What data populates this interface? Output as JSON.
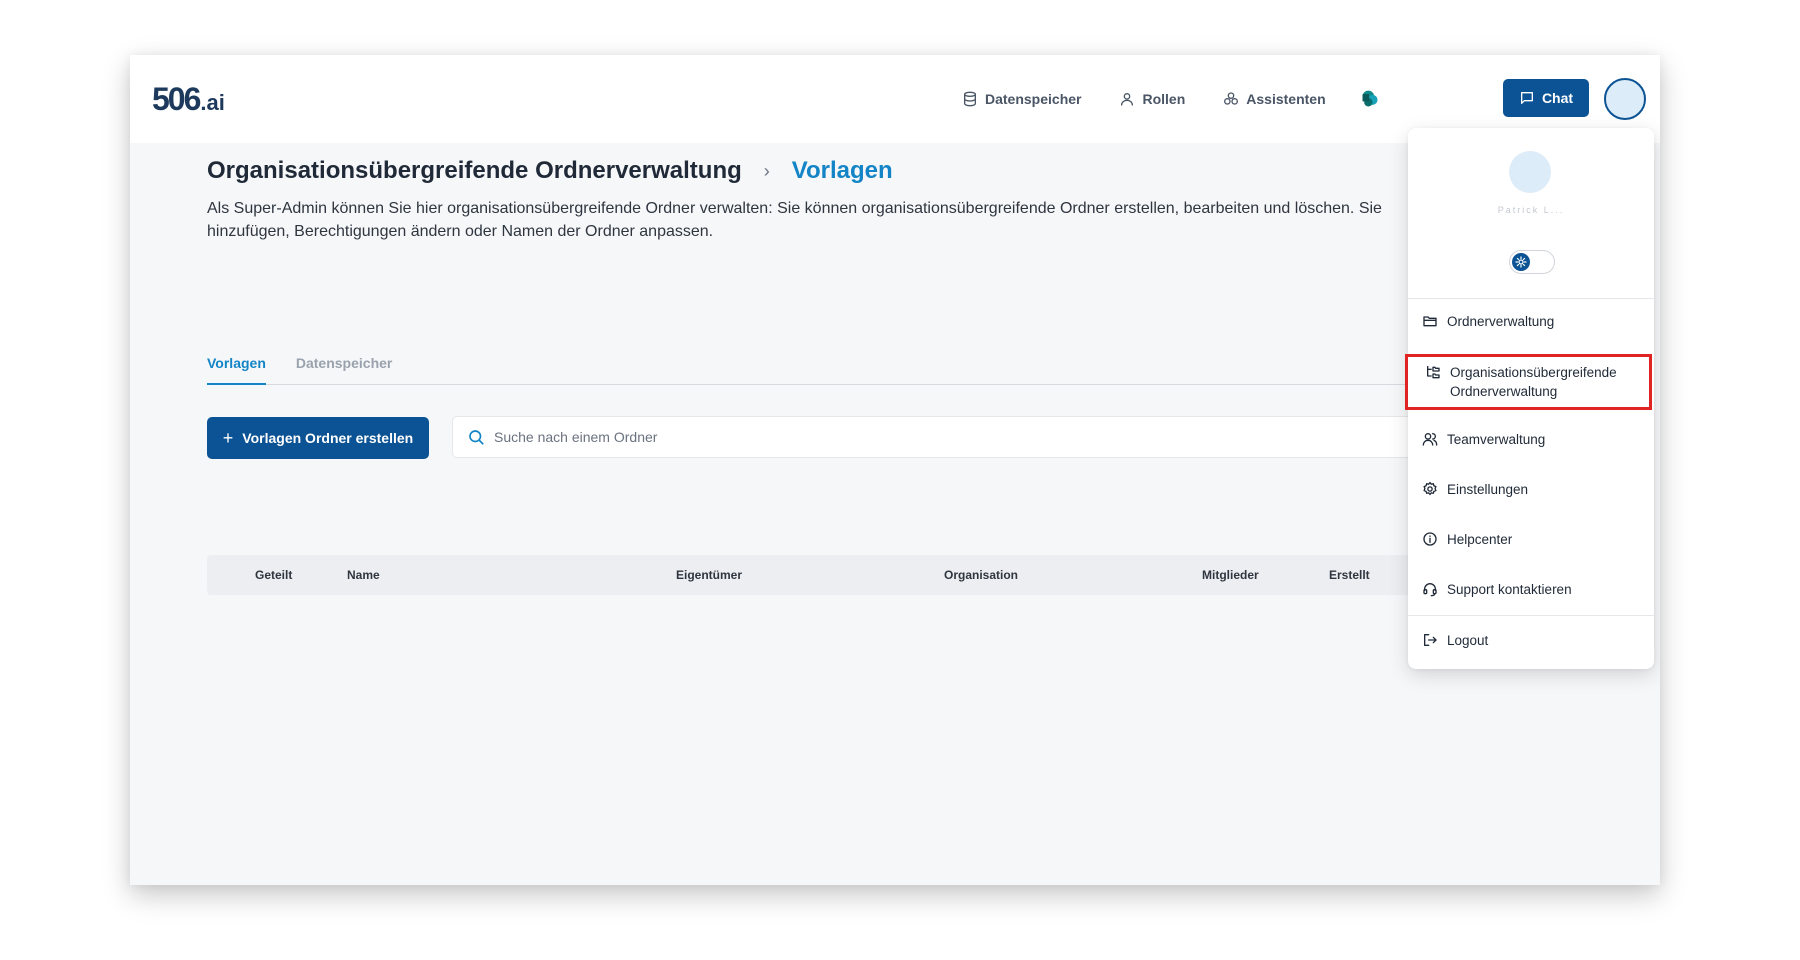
{
  "header": {
    "logo_number": "506",
    "logo_suffix": ".ai",
    "nav": [
      {
        "label": "Datenspeicher",
        "icon": "database-icon"
      },
      {
        "label": "Rollen",
        "icon": "user-icon"
      },
      {
        "label": "Assistenten",
        "icon": "assistants-icon"
      }
    ],
    "chat_label": "Chat"
  },
  "page": {
    "breadcrumb_root": "Organisationsübergreifende Ordnerverwaltung",
    "breadcrumb_separator": "›",
    "breadcrumb_current": "Vorlagen",
    "description": "Als Super-Admin können Sie hier organisationsübergreifende Ordner verwalten: Sie können organisationsübergreifende Ordner erstellen, bearbeiten und löschen. Sie hinzufügen, Berechtigungen ändern oder Namen der Ordner anpassen.",
    "tabs": [
      {
        "label": "Vorlagen",
        "active": true
      },
      {
        "label": "Datenspeicher",
        "active": false
      }
    ],
    "create_button": "Vorlagen Ordner erstellen",
    "search_placeholder": "Suche nach einem Ordner",
    "table_headers": [
      "Geteilt",
      "Name",
      "Eigentümer",
      "Organisation",
      "Mitglieder",
      "Erstellt"
    ]
  },
  "user_menu": {
    "username": "Patrick L...",
    "items": [
      {
        "label": "Ordnerverwaltung",
        "icon": "folder-icon"
      },
      {
        "label": "Organisationsübergreifende Ordnerverwaltung",
        "icon": "folder-tree-icon",
        "highlighted": true
      },
      {
        "label": "Teamverwaltung",
        "icon": "users-icon"
      },
      {
        "label": "Einstellungen",
        "icon": "gear-icon"
      },
      {
        "label": "Helpcenter",
        "icon": "info-icon"
      },
      {
        "label": "Support kontaktieren",
        "icon": "headset-icon"
      },
      {
        "label": "Logout",
        "icon": "logout-icon"
      }
    ]
  },
  "colors": {
    "primary": "#0b5394",
    "accent": "#1385c6",
    "highlight_border": "#e02424"
  }
}
